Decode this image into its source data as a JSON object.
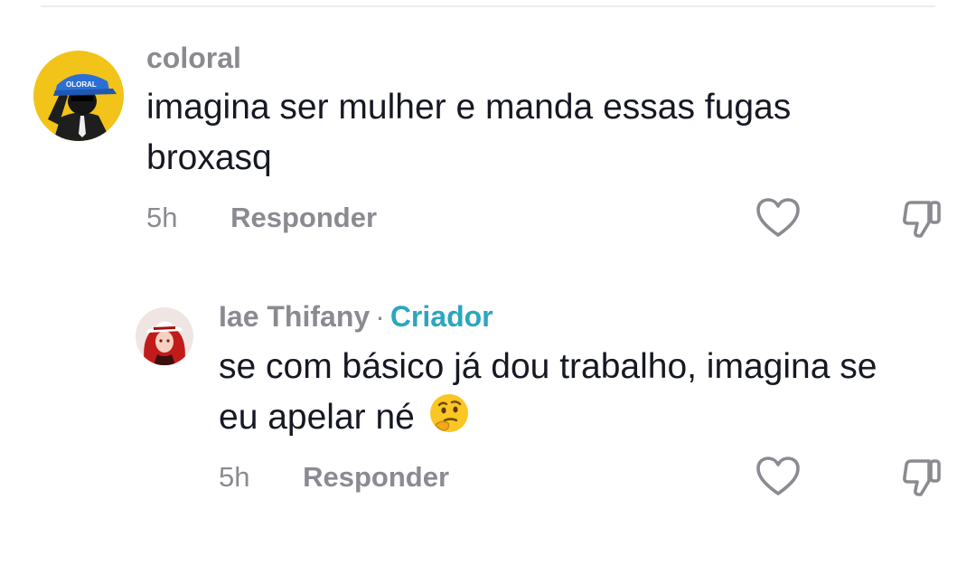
{
  "comments": [
    {
      "username": "coloral",
      "text_line1": "imagina ser mulher e manda essas fugas",
      "text_line2": "broxasq",
      "time": "5h",
      "reply_label": "Responder",
      "avatar_cap_text": "OLORAL"
    },
    {
      "username": "Iae Thifany",
      "separator": "·",
      "badge": "Criador",
      "text_line1": "se com básico já dou trabalho, imagina se",
      "text_line2": "eu apelar né",
      "emoji": "thinking-face",
      "time": "5h",
      "reply_label": "Responder"
    }
  ],
  "icons": {
    "like": "heart-outline-icon",
    "dislike": "thumbs-down-outline-icon"
  },
  "colors": {
    "muted": "#8a8b91",
    "creator_badge": "#2aa6c0",
    "text": "#161823",
    "icon_stroke": "#8a8b91"
  }
}
